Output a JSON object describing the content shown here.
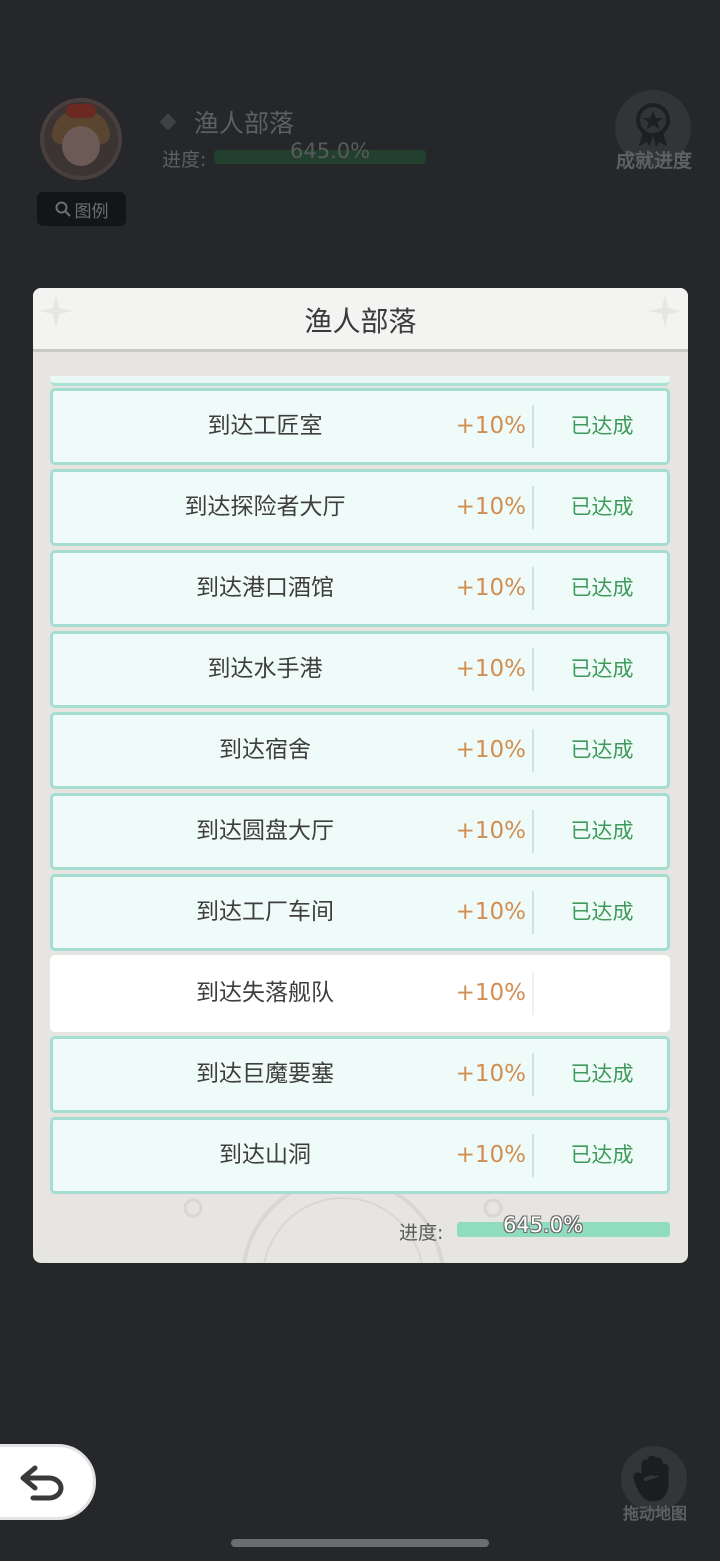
{
  "background": {
    "title": "渔人部落",
    "progress_label": "进度:",
    "progress_text": "645.0%",
    "progress_fraction": 1.0,
    "legend_label": "图例",
    "achievement_label": "成就进度"
  },
  "dialog": {
    "title": "渔人部落",
    "rows": [
      {
        "name": "到达工匠室",
        "bonus": "+10%",
        "status": "已达成",
        "done": true
      },
      {
        "name": "到达探险者大厅",
        "bonus": "+10%",
        "status": "已达成",
        "done": true
      },
      {
        "name": "到达港口酒馆",
        "bonus": "+10%",
        "status": "已达成",
        "done": true
      },
      {
        "name": "到达水手港",
        "bonus": "+10%",
        "status": "已达成",
        "done": true
      },
      {
        "name": "到达宿舍",
        "bonus": "+10%",
        "status": "已达成",
        "done": true
      },
      {
        "name": "到达圆盘大厅",
        "bonus": "+10%",
        "status": "已达成",
        "done": true
      },
      {
        "name": "到达工厂车间",
        "bonus": "+10%",
        "status": "已达成",
        "done": true
      },
      {
        "name": "到达失落舰队",
        "bonus": "+10%",
        "status": "",
        "done": false
      },
      {
        "name": "到达巨魔要塞",
        "bonus": "+10%",
        "status": "已达成",
        "done": true
      },
      {
        "name": "到达山洞",
        "bonus": "+10%",
        "status": "已达成",
        "done": true
      }
    ],
    "footer": {
      "progress_label": "进度:",
      "progress_text": "645.0%",
      "progress_fraction": 1.0
    }
  },
  "controls": {
    "drag_map_label": "拖动地图"
  },
  "colors": {
    "accent_teal": "#8fdcbf",
    "bonus_orange": "#d08e52",
    "done_green": "#3e9a5a"
  }
}
